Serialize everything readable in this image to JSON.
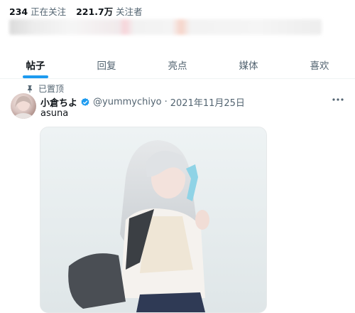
{
  "profile_stats": {
    "following_count": "234",
    "following_label": "正在关注",
    "followers_count": "221.7万",
    "followers_label": "关注者"
  },
  "tabs": [
    {
      "label": "帖子",
      "active": true
    },
    {
      "label": "回复",
      "active": false
    },
    {
      "label": "亮点",
      "active": false
    },
    {
      "label": "媒体",
      "active": false
    },
    {
      "label": "喜欢",
      "active": false
    }
  ],
  "pinned_post": {
    "pinned_label": "已置顶",
    "author_name": "小倉ちよ",
    "handle": "@yummychiyo",
    "separator": "·",
    "date": "2021年11月25日",
    "text": "asuna",
    "more_icon": "more-horizontal-icon",
    "verified_icon": "verified-badge-icon"
  },
  "colors": {
    "accent": "#1d9bf0",
    "text_primary": "#0f1419",
    "text_secondary": "#536471"
  }
}
